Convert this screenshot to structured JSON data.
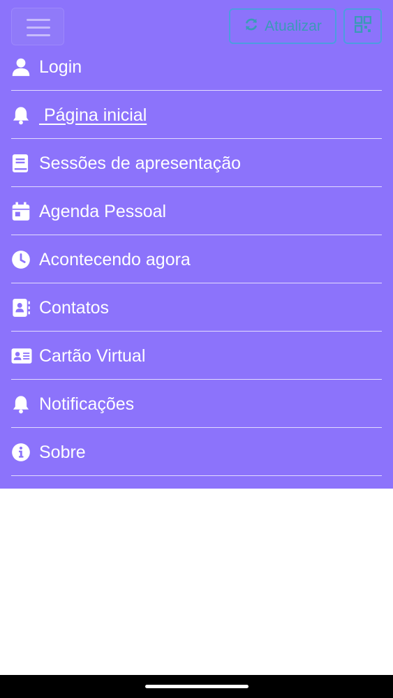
{
  "header": {
    "refresh_label": "Atualizar"
  },
  "menu": {
    "items": [
      {
        "label": "Login",
        "icon": "user-icon"
      },
      {
        "label": " Página inicial",
        "icon": "bell-icon",
        "active": true
      },
      {
        "label": "Sessões de apresentação",
        "icon": "book-icon"
      },
      {
        "label": "Agenda Pessoal",
        "icon": "calendar-icon"
      },
      {
        "label": "Acontecendo agora",
        "icon": "clock-icon"
      },
      {
        "label": "Contatos",
        "icon": "address-book-icon"
      },
      {
        "label": "Cartão Virtual",
        "icon": "id-card-icon"
      },
      {
        "label": "Notificações",
        "icon": "bell-icon"
      },
      {
        "label": "Sobre",
        "icon": "info-icon"
      }
    ]
  },
  "colors": {
    "panel_background": "#8c73fb",
    "button_border": "#4c9de0",
    "text": "#ffffff"
  }
}
